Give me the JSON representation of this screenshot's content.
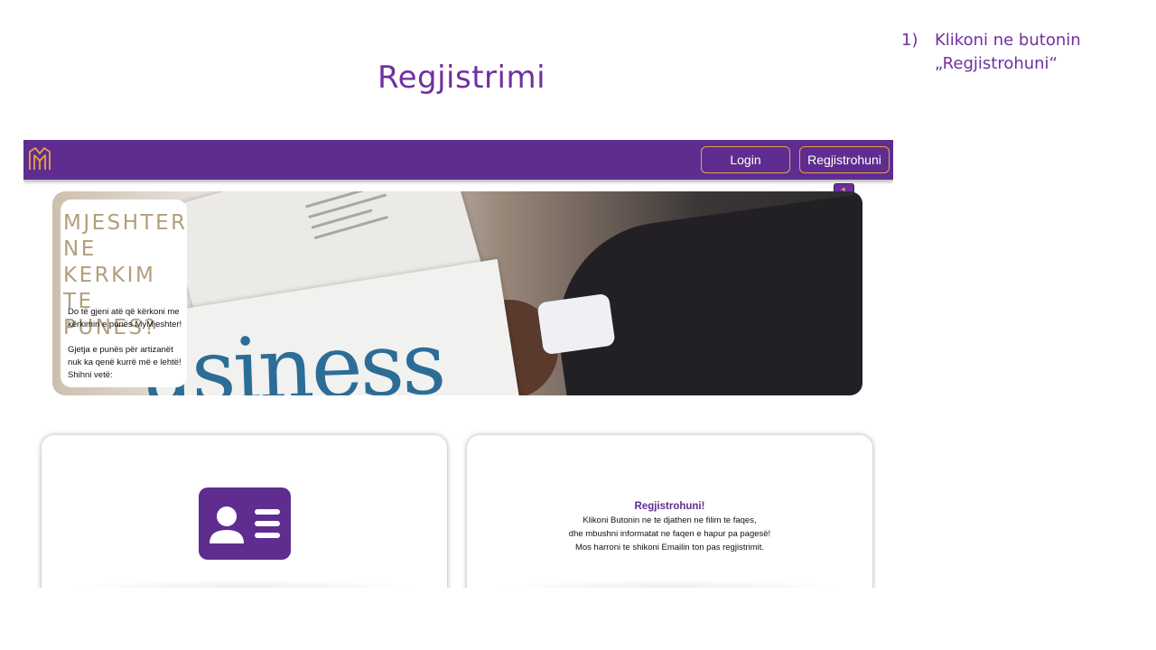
{
  "slide": {
    "title": "Regjistrimi",
    "instruction_number": "1)",
    "instruction_text": "Klikoni ne butonin „Regjistrohuni“",
    "accent_color": "#7030a0"
  },
  "navbar": {
    "logo_icon": "mymjeshter-logo-icon",
    "login_label": "Login",
    "register_label": "Regjistrohuni",
    "bg_color": "#5f2d8f",
    "button_border_color": "#e8a24a"
  },
  "marker": {
    "label": "1"
  },
  "hero": {
    "headline": "MJESHTER\nNE KERKIM\nTE PUNES?",
    "body": "Do të gjeni atë që kërkoni me kërkimin e punës MyMjeshter!\n\nGjetja e punës për artizanët nuk ka qenë kurrë më e lehtë! Shihni vetë:",
    "image_word": "usiness"
  },
  "cards": {
    "left": {
      "icon": "id-card-icon"
    },
    "right": {
      "title": "Regjistrohuni!",
      "lines": [
        "Klikoni Butonin ne te djathen ne filim te faqes,",
        "dhe mbushni informatat ne faqen e hapur pa pagesë!",
        "Mos harroni te shikoni Emailin ton pas regjistrimit."
      ]
    }
  }
}
